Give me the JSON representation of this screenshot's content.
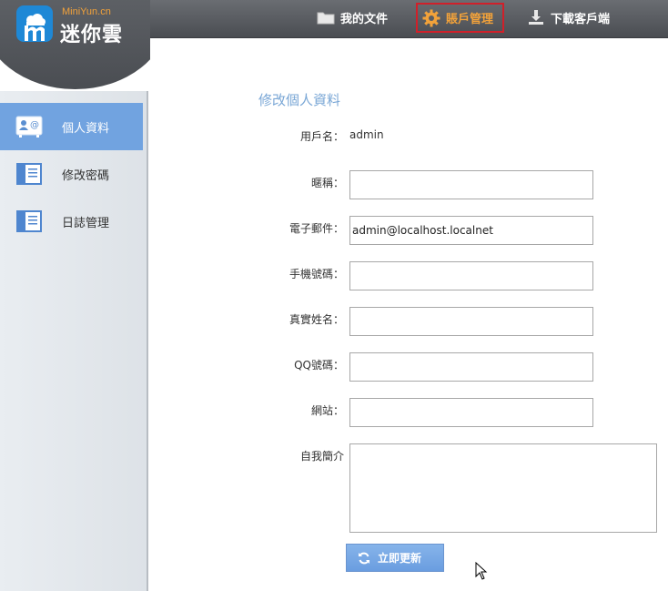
{
  "brand": {
    "small": "MiniYun.cn",
    "name": "迷你雲"
  },
  "topnav": {
    "files": "我的文件",
    "account": "賬戶管理",
    "download": "下載客戶端"
  },
  "sidebar": {
    "items": [
      {
        "label": "個人資料",
        "icon": "contact-card-icon",
        "active": true
      },
      {
        "label": "修改密碼",
        "icon": "notebook-icon",
        "active": false
      },
      {
        "label": "日誌管理",
        "icon": "notebook-icon",
        "active": false
      }
    ]
  },
  "form": {
    "title": "修改個人資料",
    "username_label": "用戶名：",
    "username_value": "admin",
    "nickname_label": "暱稱：",
    "nickname_value": "",
    "email_label": "電子郵件：",
    "email_value": "admin@localhost.localnet",
    "phone_label": "手機號碼：",
    "phone_value": "",
    "realname_label": "真實姓名：",
    "realname_value": "",
    "qq_label": "QQ號碼：",
    "qq_value": "",
    "website_label": "網站：",
    "website_value": "",
    "bio_label": "自我簡介",
    "bio_value": "",
    "submit_label": "立即更新"
  },
  "colors": {
    "accent": "#71a3e0",
    "nav_active": "#f2a23a",
    "highlight_box": "#d0202a",
    "title": "#7aa7d6"
  }
}
